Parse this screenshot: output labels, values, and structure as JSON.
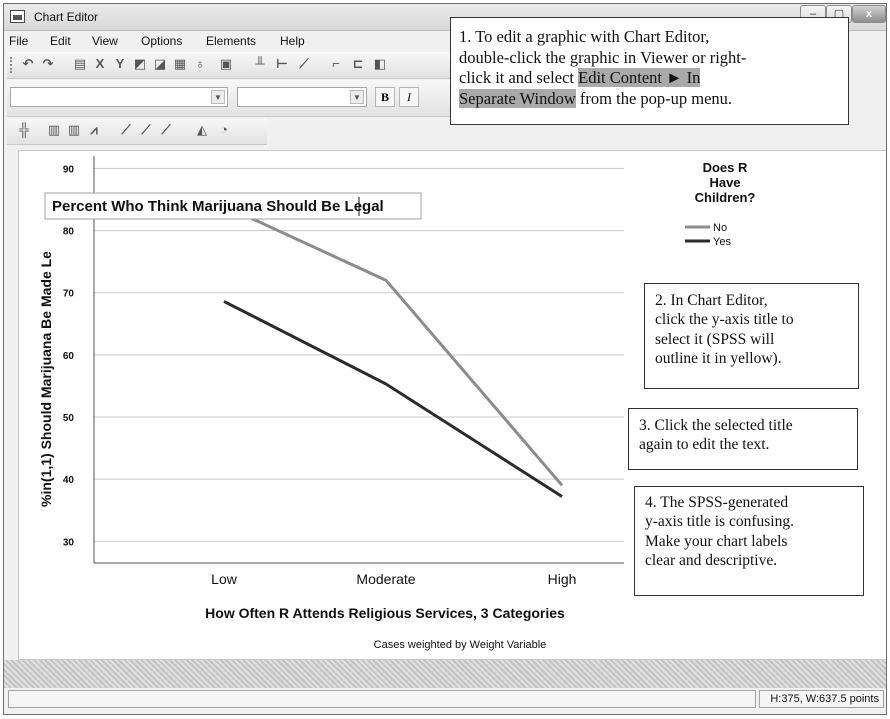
{
  "window": {
    "title": "Chart Editor",
    "close_glyph": "x"
  },
  "menu": {
    "items": [
      {
        "label": "File"
      },
      {
        "label": "Edit"
      },
      {
        "label": "View"
      },
      {
        "label": "Options"
      },
      {
        "label": "Elements"
      },
      {
        "label": "Help"
      }
    ]
  },
  "toolbar": {
    "icons": [
      "undo-icon",
      "redo-icon",
      "properties-icon",
      "x-axis-select-icon",
      "y-axis-select-icon",
      "scale-icon",
      "zoom-icon",
      "data-labels-icon",
      "lasso-icon",
      "table-icon",
      "error-bar-icon",
      "line-chart-icon",
      "chart-type-icon",
      "bar-style-icon",
      "grid-icon",
      "pie-icon",
      "area-icon",
      "rotate-icon"
    ],
    "format": {
      "bold": "B",
      "italic": "I"
    }
  },
  "chart_data": {
    "type": "line",
    "title": "Percent Who Think Marijuana Should Be Legal",
    "xlabel": "How Often R Attends Religious Services, 3 Categories",
    "ylabel": "%in(1,1) Should Marijuana Be Made Le",
    "footnote": "Cases weighted by Weight Variable",
    "categories": [
      "Low",
      "Moderate",
      "High"
    ],
    "yticks": [
      30,
      40,
      50,
      60,
      70,
      80,
      90
    ],
    "ylim": [
      26.5,
      92
    ],
    "grid": true,
    "legend": {
      "title": "Does R Have Children?",
      "position": "top-right"
    },
    "series": [
      {
        "name": "No",
        "values": [
          84.0,
          72.0,
          39.0
        ],
        "color": "#8c8c8c"
      },
      {
        "name": "Yes",
        "values": [
          68.6,
          55.3,
          37.2
        ],
        "color": "#2b2b2b"
      }
    ]
  },
  "callouts": {
    "c1": {
      "line1": "1. To edit a graphic with Chart Editor,",
      "line2": "double-click the graphic in Viewer or right-",
      "line3": "click it and select ",
      "highlight1": "Edit Content ► In",
      "highlight2": "Separate Window",
      "line4_tail": " from the pop-up menu."
    },
    "c2": {
      "lines": [
        "2. In Chart Editor,",
        "click the y-axis title to",
        "select it (SPSS will",
        "outline it in yellow)."
      ]
    },
    "c3": {
      "lines": [
        "3. Click the selected title",
        "again to edit the text."
      ]
    },
    "c4": {
      "lines": [
        "4. The SPSS-generated",
        "y-axis title is confusing.",
        "Make your chart labels",
        "clear and descriptive."
      ]
    }
  },
  "status": {
    "dimensions": "H:375, W:637.5 points"
  },
  "colors": {
    "window_bg": "#f0f0f0",
    "highlight": "#a9a9a9",
    "series_no": "#8c8c8c",
    "series_yes": "#2b2b2b"
  }
}
